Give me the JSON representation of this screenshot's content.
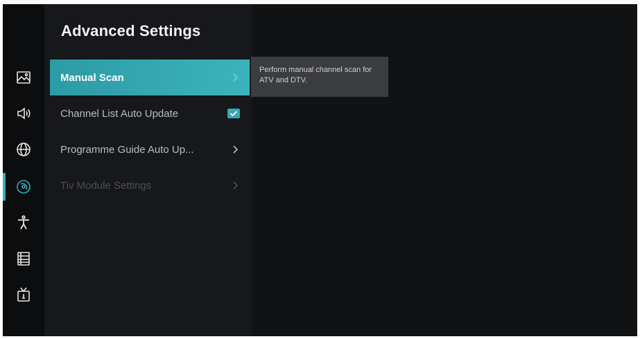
{
  "page": {
    "title": "Advanced Settings"
  },
  "sidebar": {
    "items": [
      {
        "icon": "picture-icon",
        "active": false
      },
      {
        "icon": "sound-icon",
        "active": false
      },
      {
        "icon": "network-icon",
        "active": false
      },
      {
        "icon": "channel-icon",
        "active": true
      },
      {
        "icon": "accessibility-icon",
        "active": false
      },
      {
        "icon": "system-icon",
        "active": false
      },
      {
        "icon": "support-icon",
        "active": false
      }
    ]
  },
  "menu": {
    "items": [
      {
        "label": "Manual Scan",
        "type": "submenu",
        "state": "focused"
      },
      {
        "label": "Channel List Auto Update",
        "type": "checkbox",
        "checked": true
      },
      {
        "label": "Programme Guide Auto Up...",
        "type": "submenu"
      },
      {
        "label": "Tiv Module Settings",
        "type": "submenu",
        "state": "disabled"
      }
    ]
  },
  "tooltip": {
    "text": "Perform manual channel scan for ATV and DTV."
  },
  "colors": {
    "accent": "#33b0b8",
    "background": "#111214",
    "tooltip_bg": "#3a3c40"
  }
}
